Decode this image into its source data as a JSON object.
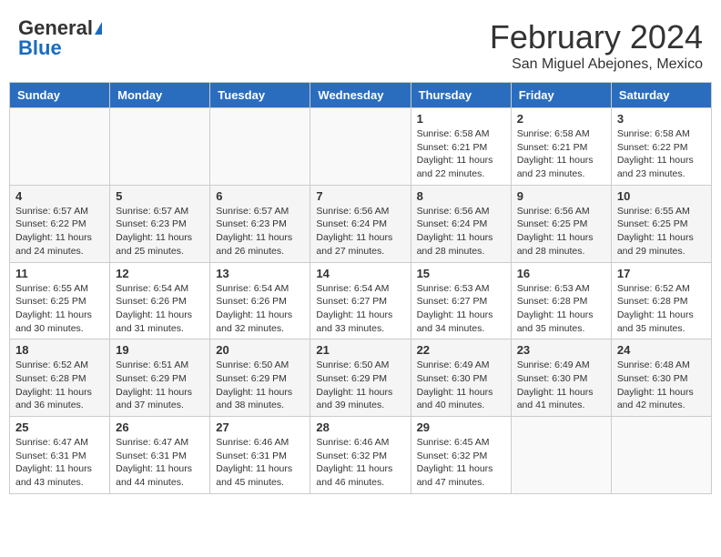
{
  "header": {
    "logo_general": "General",
    "logo_blue": "Blue",
    "month": "February 2024",
    "location": "San Miguel Abejones, Mexico"
  },
  "days_of_week": [
    "Sunday",
    "Monday",
    "Tuesday",
    "Wednesday",
    "Thursday",
    "Friday",
    "Saturday"
  ],
  "weeks": [
    [
      {
        "day": "",
        "info": ""
      },
      {
        "day": "",
        "info": ""
      },
      {
        "day": "",
        "info": ""
      },
      {
        "day": "",
        "info": ""
      },
      {
        "day": "1",
        "info": "Sunrise: 6:58 AM\nSunset: 6:21 PM\nDaylight: 11 hours\nand 22 minutes."
      },
      {
        "day": "2",
        "info": "Sunrise: 6:58 AM\nSunset: 6:21 PM\nDaylight: 11 hours\nand 23 minutes."
      },
      {
        "day": "3",
        "info": "Sunrise: 6:58 AM\nSunset: 6:22 PM\nDaylight: 11 hours\nand 23 minutes."
      }
    ],
    [
      {
        "day": "4",
        "info": "Sunrise: 6:57 AM\nSunset: 6:22 PM\nDaylight: 11 hours\nand 24 minutes."
      },
      {
        "day": "5",
        "info": "Sunrise: 6:57 AM\nSunset: 6:23 PM\nDaylight: 11 hours\nand 25 minutes."
      },
      {
        "day": "6",
        "info": "Sunrise: 6:57 AM\nSunset: 6:23 PM\nDaylight: 11 hours\nand 26 minutes."
      },
      {
        "day": "7",
        "info": "Sunrise: 6:56 AM\nSunset: 6:24 PM\nDaylight: 11 hours\nand 27 minutes."
      },
      {
        "day": "8",
        "info": "Sunrise: 6:56 AM\nSunset: 6:24 PM\nDaylight: 11 hours\nand 28 minutes."
      },
      {
        "day": "9",
        "info": "Sunrise: 6:56 AM\nSunset: 6:25 PM\nDaylight: 11 hours\nand 28 minutes."
      },
      {
        "day": "10",
        "info": "Sunrise: 6:55 AM\nSunset: 6:25 PM\nDaylight: 11 hours\nand 29 minutes."
      }
    ],
    [
      {
        "day": "11",
        "info": "Sunrise: 6:55 AM\nSunset: 6:25 PM\nDaylight: 11 hours\nand 30 minutes."
      },
      {
        "day": "12",
        "info": "Sunrise: 6:54 AM\nSunset: 6:26 PM\nDaylight: 11 hours\nand 31 minutes."
      },
      {
        "day": "13",
        "info": "Sunrise: 6:54 AM\nSunset: 6:26 PM\nDaylight: 11 hours\nand 32 minutes."
      },
      {
        "day": "14",
        "info": "Sunrise: 6:54 AM\nSunset: 6:27 PM\nDaylight: 11 hours\nand 33 minutes."
      },
      {
        "day": "15",
        "info": "Sunrise: 6:53 AM\nSunset: 6:27 PM\nDaylight: 11 hours\nand 34 minutes."
      },
      {
        "day": "16",
        "info": "Sunrise: 6:53 AM\nSunset: 6:28 PM\nDaylight: 11 hours\nand 35 minutes."
      },
      {
        "day": "17",
        "info": "Sunrise: 6:52 AM\nSunset: 6:28 PM\nDaylight: 11 hours\nand 35 minutes."
      }
    ],
    [
      {
        "day": "18",
        "info": "Sunrise: 6:52 AM\nSunset: 6:28 PM\nDaylight: 11 hours\nand 36 minutes."
      },
      {
        "day": "19",
        "info": "Sunrise: 6:51 AM\nSunset: 6:29 PM\nDaylight: 11 hours\nand 37 minutes."
      },
      {
        "day": "20",
        "info": "Sunrise: 6:50 AM\nSunset: 6:29 PM\nDaylight: 11 hours\nand 38 minutes."
      },
      {
        "day": "21",
        "info": "Sunrise: 6:50 AM\nSunset: 6:29 PM\nDaylight: 11 hours\nand 39 minutes."
      },
      {
        "day": "22",
        "info": "Sunrise: 6:49 AM\nSunset: 6:30 PM\nDaylight: 11 hours\nand 40 minutes."
      },
      {
        "day": "23",
        "info": "Sunrise: 6:49 AM\nSunset: 6:30 PM\nDaylight: 11 hours\nand 41 minutes."
      },
      {
        "day": "24",
        "info": "Sunrise: 6:48 AM\nSunset: 6:30 PM\nDaylight: 11 hours\nand 42 minutes."
      }
    ],
    [
      {
        "day": "25",
        "info": "Sunrise: 6:47 AM\nSunset: 6:31 PM\nDaylight: 11 hours\nand 43 minutes."
      },
      {
        "day": "26",
        "info": "Sunrise: 6:47 AM\nSunset: 6:31 PM\nDaylight: 11 hours\nand 44 minutes."
      },
      {
        "day": "27",
        "info": "Sunrise: 6:46 AM\nSunset: 6:31 PM\nDaylight: 11 hours\nand 45 minutes."
      },
      {
        "day": "28",
        "info": "Sunrise: 6:46 AM\nSunset: 6:32 PM\nDaylight: 11 hours\nand 46 minutes."
      },
      {
        "day": "29",
        "info": "Sunrise: 6:45 AM\nSunset: 6:32 PM\nDaylight: 11 hours\nand 47 minutes."
      },
      {
        "day": "",
        "info": ""
      },
      {
        "day": "",
        "info": ""
      }
    ]
  ]
}
